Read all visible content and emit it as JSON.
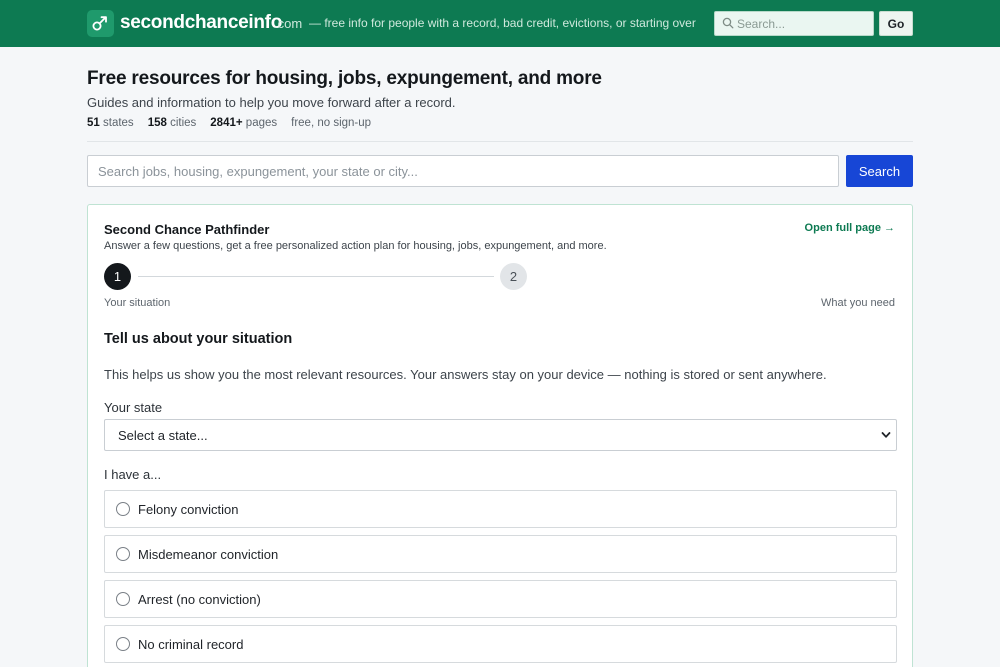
{
  "header": {
    "brand": "secondchanceinfo",
    "brand_tld": ".com",
    "tagline": "— free info for people with a record, bad credit, evictions, or starting over",
    "search_placeholder": "Search...",
    "go_label": "Go",
    "brand_color": "#0d7a52"
  },
  "hero": {
    "title": "Free resources for housing, jobs, expungement, and more",
    "subtitle": "Guides and information to help you move forward after a record.",
    "stats": [
      {
        "value": "51",
        "label": "states"
      },
      {
        "value": "158",
        "label": "cities"
      },
      {
        "value": "2841+",
        "label": "pages"
      }
    ],
    "stats_note": "free, no sign-up"
  },
  "main_search": {
    "placeholder": "Search jobs, housing, expungement, your state or city...",
    "button_label": "Search",
    "button_color": "#1746d6"
  },
  "pathfinder": {
    "title": "Second Chance Pathfinder",
    "subtitle": "Answer a few questions, get a free personalized action plan for housing, jobs, expungement, and more.",
    "open_link": "Open full page →",
    "steps": [
      {
        "number": "1",
        "label": "Your situation"
      },
      {
        "number": "2",
        "label": "What you need"
      }
    ],
    "section_title": "Tell us about your situation",
    "section_desc": "This helps us show you the most relevant resources. Your answers stay on your device — nothing is stored or sent anywhere.",
    "state_label": "Your state",
    "state_value": "Select a state...",
    "have_label": "I have a...",
    "options": [
      {
        "label": "Felony conviction"
      },
      {
        "label": "Misdemeanor conviction"
      },
      {
        "label": "Arrest (no conviction)"
      },
      {
        "label": "No criminal record"
      }
    ]
  }
}
